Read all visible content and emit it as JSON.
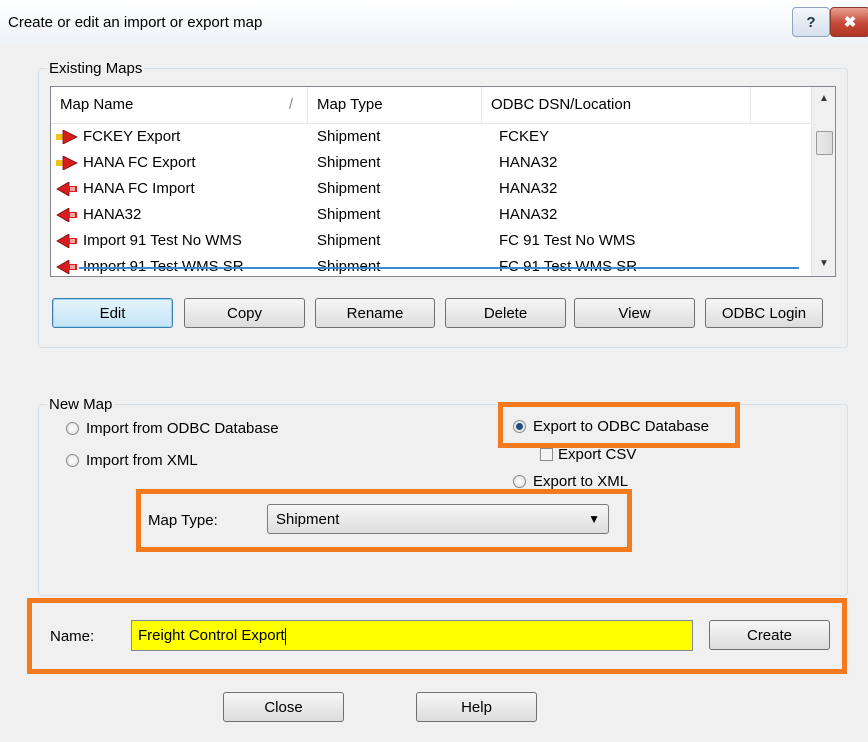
{
  "window": {
    "title": "Create or edit an import or export map",
    "help_button": "?",
    "close_button": "✖"
  },
  "existing_maps": {
    "legend": "Existing Maps",
    "columns": [
      "Map Name",
      "Map Type",
      "ODBC DSN/Location"
    ],
    "sort_indicator": "/",
    "rows": [
      {
        "name": "FCKEY Export",
        "type": "Shipment",
        "dsn": "FCKEY",
        "direction": "export"
      },
      {
        "name": "HANA FC Export",
        "type": "Shipment",
        "dsn": "HANA32",
        "direction": "export"
      },
      {
        "name": "HANA FC Import",
        "type": "Shipment",
        "dsn": "HANA32",
        "direction": "import"
      },
      {
        "name": "HANA32",
        "type": "Shipment",
        "dsn": "HANA32",
        "direction": "import"
      },
      {
        "name": "Import 91 Test No WMS",
        "type": "Shipment",
        "dsn": "FC 91 Test No WMS",
        "direction": "import"
      },
      {
        "name": "Import 91 Test WMS SR",
        "type": "Shipment",
        "dsn": "FC 91 Test WMS SR",
        "direction": "import"
      }
    ],
    "buttons": [
      "Edit",
      "Copy",
      "Rename",
      "Delete",
      "View",
      "ODBC Login"
    ],
    "scroll_up": "▲",
    "scroll_down": "▼",
    "icon_colors": {
      "arrow": "#d81e1e",
      "export_tail": "#f2c21a"
    }
  },
  "new_map": {
    "legend": "New Map",
    "import_odbc": "Import from ODBC Database",
    "import_xml": "Import from XML",
    "export_odbc": "Export to ODBC Database",
    "export_csv": "Export CSV",
    "export_xml": "Export to XML",
    "selected": "export_odbc",
    "map_type_label": "Map Type:",
    "map_type_value": "Shipment",
    "combo_caret": "▼"
  },
  "name_row": {
    "label": "Name:",
    "value": "Freight Control Export",
    "create_button": "Create"
  },
  "footer": {
    "close_button": "Close",
    "help_button": "Help"
  },
  "colors": {
    "highlight": "#f37a1f",
    "name_field_bg": "#ffff00"
  }
}
